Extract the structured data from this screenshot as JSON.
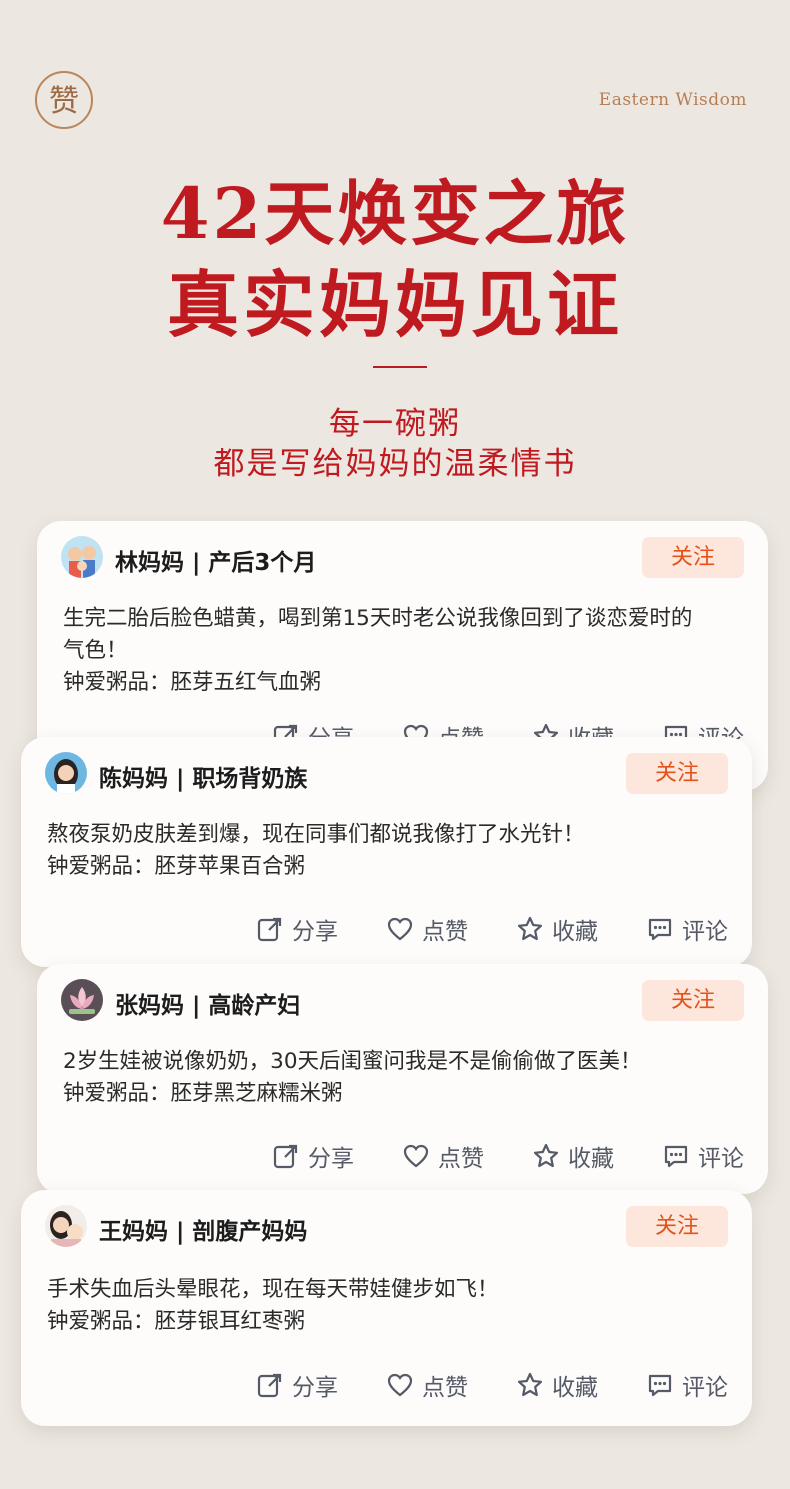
{
  "header": {
    "seal_char": "赞",
    "brand": "Eastern Wisdom",
    "headline_1": "42天焕变之旅",
    "headline_2": "真实妈妈见证",
    "sub_1": "每一碗粥",
    "sub_2": "都是写给妈妈的温柔情书"
  },
  "colors": {
    "accent": "#c01a21",
    "follow_bg": "#fde7dc",
    "follow_text": "#e4531a",
    "background": "#ece8e1"
  },
  "actions": {
    "share": "分享",
    "like": "点赞",
    "favorite": "收藏",
    "comment": "评论"
  },
  "posts": [
    {
      "name": "林妈妈 | 产后3个月",
      "follow": "关注",
      "text": "生完二胎后脸色蜡黄，喝到第15天时老公说我像回到了谈恋爱时的气色！",
      "product": "钟爱粥品：胚芽五红气血粥",
      "avatar": "family-avatar"
    },
    {
      "name": "陈妈妈 | 职场背奶族",
      "follow": "关注",
      "text": "熬夜泵奶皮肤差到爆，现在同事们都说我像打了水光针！",
      "product": "钟爱粥品：胚芽苹果百合粥",
      "avatar": "woman-avatar"
    },
    {
      "name": "张妈妈 | 高龄产妇",
      "follow": "关注",
      "text": "2岁生娃被说像奶奶，30天后闺蜜问我是不是偷偷做了医美！",
      "product": "钟爱粥品：胚芽黑芝麻糯米粥",
      "avatar": "lotus-avatar"
    },
    {
      "name": "王妈妈 | 剖腹产妈妈",
      "follow": "关注",
      "text": "手术失血后头晕眼花，现在每天带娃健步如飞！",
      "product": "钟爱粥品：胚芽银耳红枣粥",
      "avatar": "mother-baby-avatar"
    }
  ]
}
